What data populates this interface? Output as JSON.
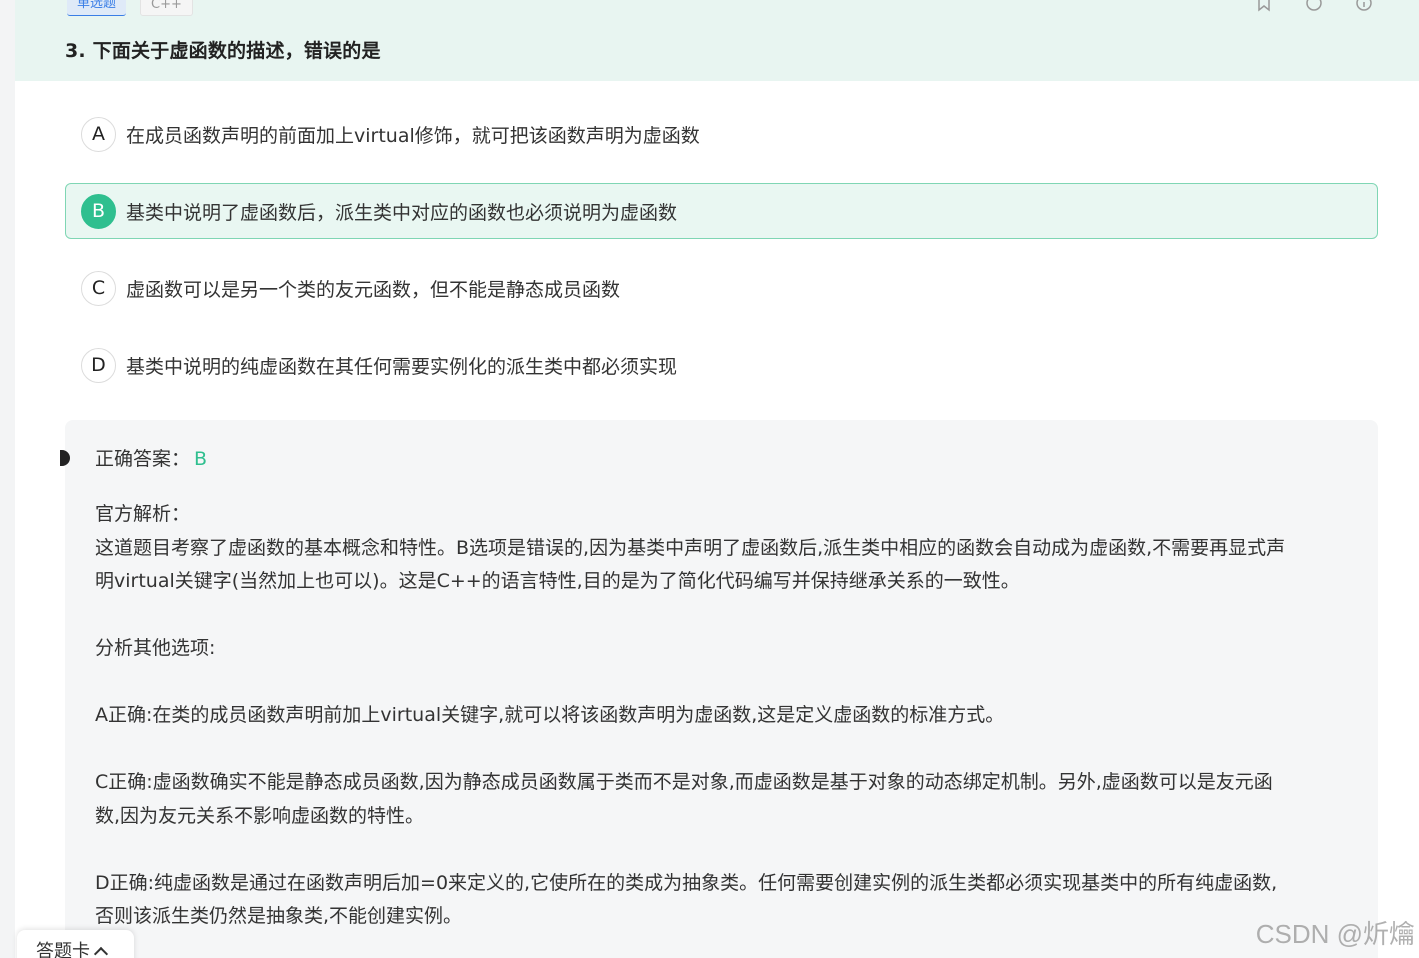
{
  "header": {
    "tag_type": "单选题",
    "tag_lang": "C++",
    "question_title": "3. 下面关于虚函数的描述，错误的是",
    "icons": [
      "bookmark-icon",
      "refresh-icon",
      "info-icon"
    ]
  },
  "options": [
    {
      "letter": "A",
      "text": "在成员函数声明的前面加上virtual修饰，就可把该函数声明为虚函数",
      "selected": false
    },
    {
      "letter": "B",
      "text": "基类中说明了虚函数后，派生类中对应的函数也必须说明为虚函数",
      "selected": true
    },
    {
      "letter": "C",
      "text": "虚函数可以是另一个类的友元函数，但不能是静态成员函数",
      "selected": false
    },
    {
      "letter": "D",
      "text": "基类中说明的纯虚函数在其任何需要实例化的派生类中都必须实现",
      "selected": false
    }
  ],
  "answer": {
    "label": "正确答案：",
    "value": "B",
    "analysis": "官方解析：\n这道题目考察了虚函数的基本概念和特性。B选项是错误的,因为基类中声明了虚函数后,派生类中相应的函数会自动成为虚函数,不需要再显式声\n明virtual关键字(当然加上也可以)。这是C++的语言特性,目的是为了简化代码编写并保持继承关系的一致性。\n\n分析其他选项:\n\nA正确:在类的成员函数声明前加上virtual关键字,就可以将该函数声明为虚函数,这是定义虚函数的标准方式。\n\nC正确:虚函数确实不能是静态成员函数,因为静态成员函数属于类而不是对象,而虚函数是基于对象的动态绑定机制。另外,虚函数可以是友元函\n数,因为友元关系不影响虚函数的特性。\n\nD正确:纯虚函数是通过在函数声明后加=0来定义的,它使所在的类成为抽象类。任何需要创建实例的派生类都必须实现基类中的所有纯虚函数,\n否则该派生类仍然是抽象类,不能创建实例。"
  },
  "footer": {
    "answer_sheet_label": "答题卡"
  },
  "watermark": "CSDN @炘爚",
  "colors": {
    "accent": "#2fbf8f",
    "header_bg": "#e8f5f1",
    "selected_bg": "#e9f7f2"
  }
}
